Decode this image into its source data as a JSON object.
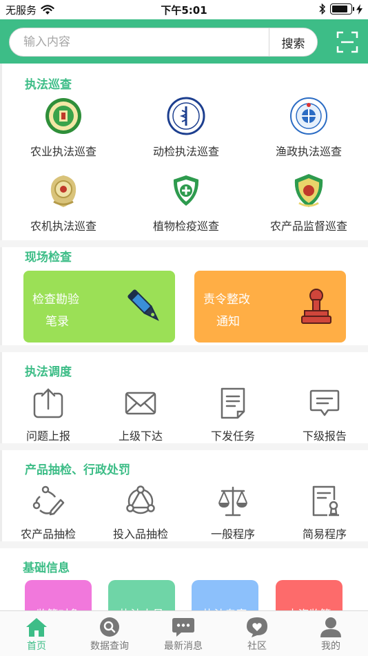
{
  "status_bar": {
    "carrier": "无服务",
    "time": "下午5:01",
    "battery_level": 0.85
  },
  "search": {
    "placeholder": "输入内容",
    "button_label": "搜索"
  },
  "sections": {
    "patrol": {
      "title": "执法巡查",
      "items": [
        {
          "label": "农业执法巡查",
          "icon": "agri-enforcement-emblem-icon"
        },
        {
          "label": "动检执法巡查",
          "icon": "animal-health-emblem-icon"
        },
        {
          "label": "渔政执法巡查",
          "icon": "fishery-emblem-icon"
        },
        {
          "label": "农机执法巡查",
          "icon": "agri-machinery-emblem-icon"
        },
        {
          "label": "植物检疫巡查",
          "icon": "plant-quarantine-emblem-icon"
        },
        {
          "label": "农产品监督巡查",
          "icon": "produce-supervision-emblem-icon"
        }
      ]
    },
    "onsite": {
      "title": "现场检查",
      "cards": [
        {
          "line1": "检查勘验",
          "line2": "笔录",
          "color": "#9be056",
          "icon": "pen-icon"
        },
        {
          "line1": "责令整改",
          "line2": "通知",
          "color": "#ffae45",
          "icon": "stamp-icon"
        }
      ]
    },
    "dispatch": {
      "title": "执法调度",
      "items": [
        {
          "label": "问题上报",
          "icon": "upload-icon"
        },
        {
          "label": "上级下达",
          "icon": "mail-icon"
        },
        {
          "label": "下发任务",
          "icon": "document-icon"
        },
        {
          "label": "下级报告",
          "icon": "message-icon"
        }
      ]
    },
    "sampling": {
      "title": "产品抽检、行政处罚",
      "items": [
        {
          "label": "农产品抽检",
          "icon": "sample-icon"
        },
        {
          "label": "投入品抽检",
          "icon": "network-icon"
        },
        {
          "label": "一般程序",
          "icon": "scales-icon"
        },
        {
          "label": "简易程序",
          "icon": "certificate-icon"
        }
      ]
    },
    "basic": {
      "title": "基础信息",
      "cards": [
        {
          "label": "监管对象",
          "color": "#f178dc"
        },
        {
          "label": "执法人员",
          "color": "#6fd5a7"
        },
        {
          "label": "执法专家",
          "color": "#8cc0fb"
        },
        {
          "label": "内资监管",
          "color": "#fd6b6b"
        }
      ]
    }
  },
  "tabbar": {
    "items": [
      {
        "label": "首页",
        "icon": "home-icon",
        "active": true
      },
      {
        "label": "数据查询",
        "icon": "search-icon",
        "active": false
      },
      {
        "label": "最新消息",
        "icon": "chat-icon",
        "active": false
      },
      {
        "label": "社区",
        "icon": "heart-bubble-icon",
        "active": false
      },
      {
        "label": "我的",
        "icon": "user-icon",
        "active": false
      }
    ]
  },
  "colors": {
    "accent": "#3dbd87",
    "icon_gray": "#6b6b6b"
  }
}
